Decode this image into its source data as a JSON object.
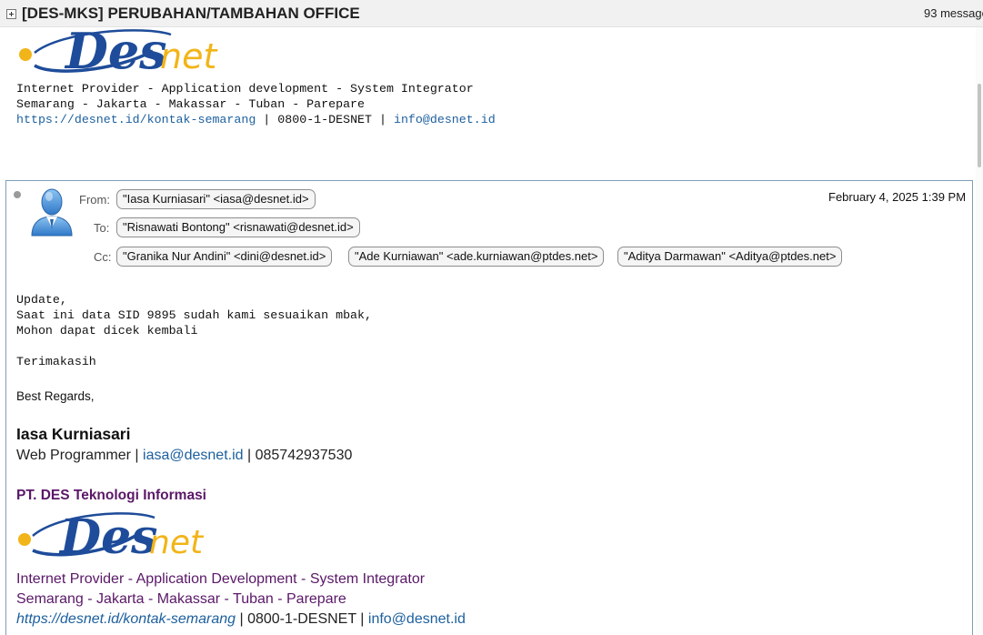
{
  "thread": {
    "title": "[DES-MKS] PERUBAHAN/TAMBAHAN OFFICE",
    "message_count": "93 message"
  },
  "logo": {
    "text_des": "Des",
    "text_net": "net"
  },
  "prev_signature": {
    "line1": "Internet Provider - Application development - System Integrator",
    "line2": "Semarang - Jakarta - Makassar - Tuban - Parepare",
    "url": "https://desnet.id/kontak-semarang",
    "sep1": " | ",
    "phone": "0800-1-DESNET",
    "sep2": " | ",
    "email": "info@desnet.id"
  },
  "message": {
    "from_label": "From:",
    "from": "\"Iasa Kurniasari\" <iasa@desnet.id>",
    "to_label": "To:",
    "to": "\"Risnawati Bontong\" <risnawati@desnet.id>",
    "cc_label": "Cc:",
    "cc": [
      "\"Granika Nur Andini\" <dini@desnet.id>",
      "\"Ade Kurniawan\" <ade.kurniawan@ptdes.net>",
      "\"Aditya Darmawan\" <Aditya@ptdes.net>"
    ],
    "date": "February 4, 2025 1:39 PM",
    "body": [
      "Update,",
      "Saat ini data SID 9895 sudah kami sesuaikan mbak,",
      "Mohon dapat dicek kembali",
      "Terimakasih"
    ],
    "regards": "Best Regards,"
  },
  "signature": {
    "name": "Iasa Kurniasari",
    "role": "Web Programmer | ",
    "email": "iasa@desnet.id",
    "phone": " | 085742937530",
    "company": "PT. DES Teknologi Informasi",
    "line1": "Internet Provider - Application Development - System Integrator",
    "line2": "Semarang - Jakarta - Makassar - Tuban - Parepare",
    "url": "https://desnet.id/kontak-semarang",
    "sep1": " | ",
    "phone2": "0800-1-DESNET",
    "sep2": " | ",
    "email2": "info@desnet.id"
  },
  "icons": {
    "expand": "plus-box-icon",
    "avatar": "user-avatar-icon",
    "unread": "unread-dot-icon"
  },
  "colors": {
    "logo_blue": "#1e4c9a",
    "logo_gold": "#f2b519",
    "signature_purple": "#5a1868",
    "link_blue": "#1c5f9e"
  }
}
